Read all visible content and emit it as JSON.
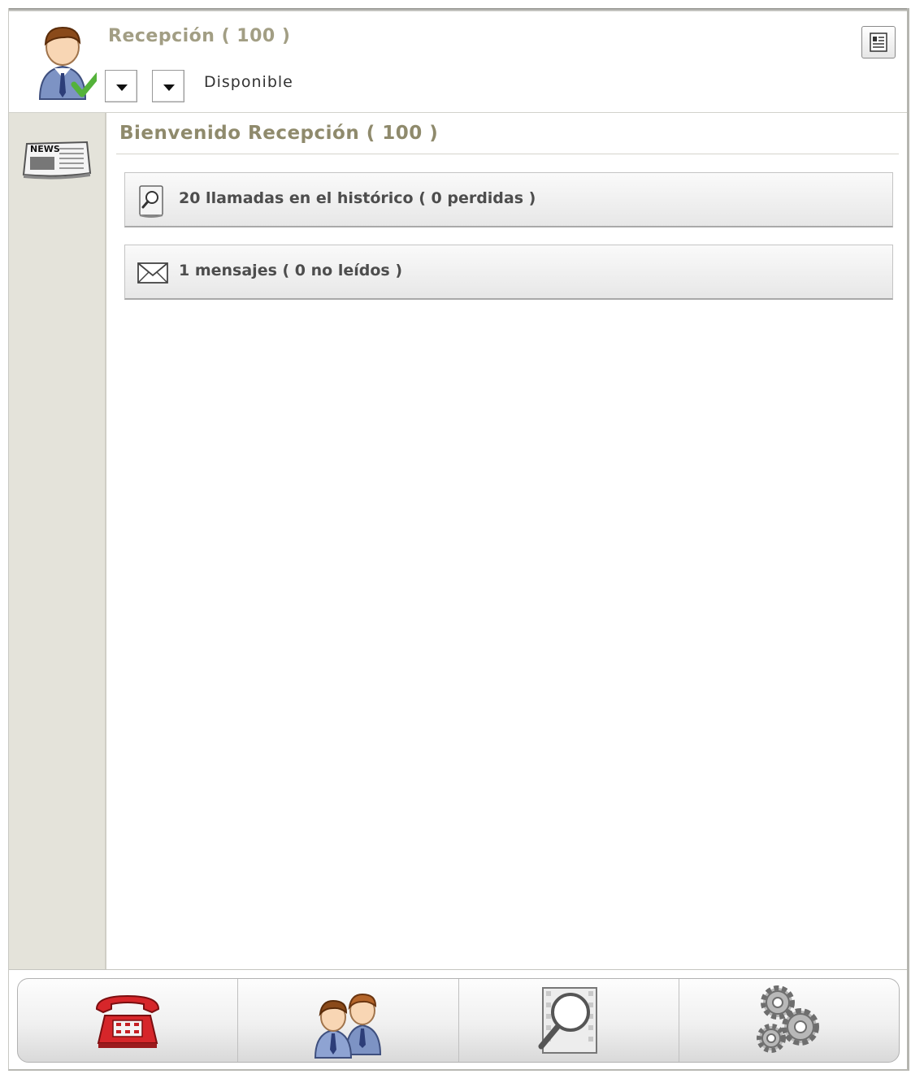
{
  "header": {
    "user_title": "Recepción ( 100 )",
    "status_text": "Disponible",
    "avatar_icon": "user-available-icon",
    "dropdown_icon": "chevron-down-icon",
    "layout_icon": "layout-toggle-icon"
  },
  "sidebar": {
    "items": [
      {
        "icon": "news-icon",
        "label": "NEWS"
      }
    ]
  },
  "main": {
    "welcome": "Bienvenido Recepción ( 100 )",
    "rows": [
      {
        "icon": "history-search-icon",
        "text": "20 llamadas en el histórico ( 0 perdidas )"
      },
      {
        "icon": "envelope-icon",
        "text": "1 mensajes ( 0 no leídos )"
      }
    ]
  },
  "footer": {
    "tabs": [
      {
        "icon": "telephone-icon"
      },
      {
        "icon": "contacts-icon"
      },
      {
        "icon": "search-log-icon"
      },
      {
        "icon": "settings-gears-icon"
      }
    ]
  },
  "colors": {
    "title": "#a29e84",
    "welcome": "#8f8a6c",
    "sidebar_bg": "#e4e3da",
    "phone_red": "#d6262a"
  }
}
